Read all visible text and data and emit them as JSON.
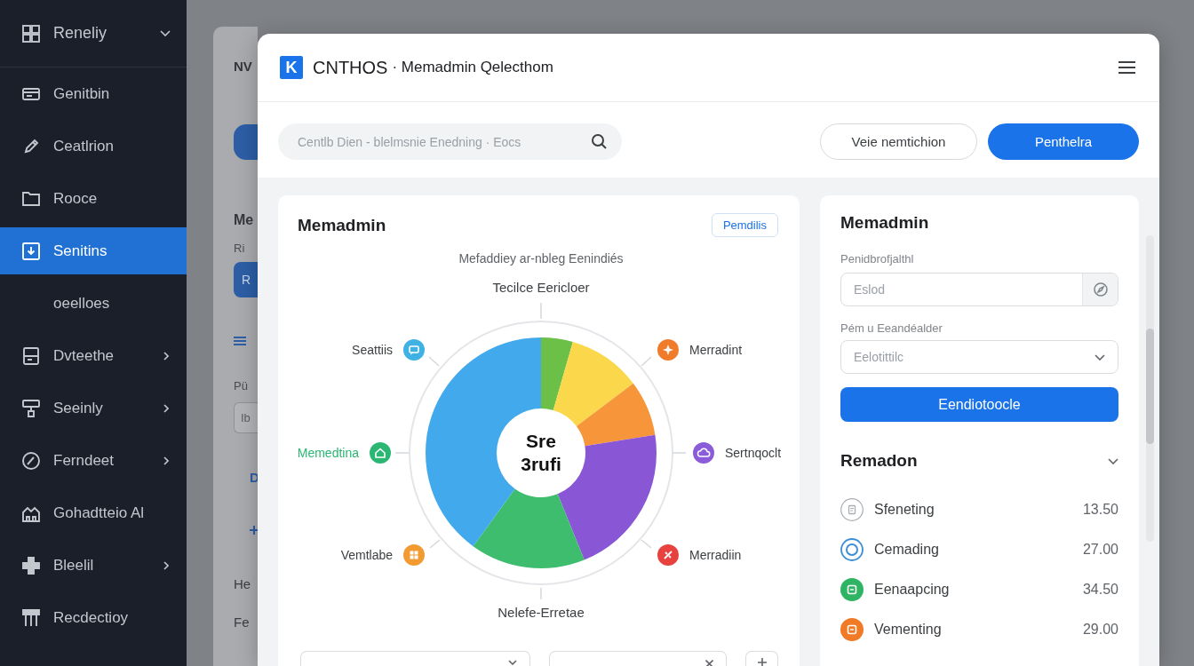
{
  "sidebar": {
    "header": {
      "label": "Reneliy",
      "expanded": true
    },
    "items": [
      {
        "label": "Genitbin",
        "selected": false,
        "has_submenu": false,
        "expanded": false
      },
      {
        "label": "Ceatlrion",
        "selected": false,
        "has_submenu": false,
        "expanded": false
      },
      {
        "label": "Rooce",
        "selected": false,
        "has_submenu": false,
        "expanded": false
      },
      {
        "label": "Senitins",
        "selected": true,
        "has_submenu": false,
        "expanded": false,
        "children": [
          {
            "label": "oeelloes",
            "selected": false
          }
        ]
      },
      {
        "label": "Dvteethe",
        "selected": false,
        "has_submenu": true,
        "expanded": false
      },
      {
        "label": "Seeinly",
        "selected": false,
        "has_submenu": true,
        "expanded": false
      },
      {
        "label": "Ferndeet",
        "selected": false,
        "has_submenu": true,
        "expanded": false
      },
      {
        "label": "Gohadtteio Al",
        "selected": false,
        "has_submenu": false,
        "expanded": false
      },
      {
        "label": "Bleelil",
        "selected": false,
        "has_submenu": true,
        "expanded": false
      },
      {
        "label": "Recdectioy",
        "selected": false,
        "has_submenu": false,
        "expanded": false
      }
    ]
  },
  "background_page": {
    "title": "NV",
    "heading": "Me",
    "caption": "Ri",
    "button": "R",
    "field_label": "Pü",
    "field_value": "Ib",
    "tab": "D",
    "rows": [
      "He",
      "Fe"
    ]
  },
  "modal": {
    "logo": "K",
    "brand": "CNTHOS",
    "title": "· Memadmin Qelecthom",
    "search": {
      "placeholder": "Centlb Dien - blelmsnie Enedning · Eocs"
    },
    "buttons": [
      {
        "label": "Veie nemtichion",
        "kind": "secondary"
      },
      {
        "label": "Penthelra",
        "kind": "primary"
      }
    ],
    "chart_card": {
      "title": "Memadmin",
      "badge": "Pemdilis",
      "subtitle": "Mefaddiey ar-nbleg Eenindiés",
      "top_label": "Tecilce Eericloer",
      "center_label": "Sre 3rufi",
      "callouts": [
        {
          "label": "Seattiis",
          "color": "#3fb1e3",
          "highlighted": false
        },
        {
          "label": "Merradint",
          "color": "#f07c2b",
          "highlighted": false
        },
        {
          "label": "Memedtina",
          "color": "#2bb673",
          "highlighted": true
        },
        {
          "label": "Sertnqoclt",
          "color": "#8b5cd9",
          "highlighted": false
        },
        {
          "label": "Vemtlabe",
          "color": "#f39b33",
          "highlighted": false
        },
        {
          "label": "Merradiin",
          "color": "#e8423f",
          "highlighted": false
        }
      ],
      "bottom_label": "Nelefe-Erretae",
      "filters": [
        {
          "kind": "select"
        },
        {
          "kind": "clearable"
        },
        {
          "kind": "add"
        }
      ]
    },
    "form_card": {
      "title": "Memadmin",
      "fields": [
        {
          "label": "Penidbrofjalthl",
          "kind": "input",
          "placeholder": "Eslod"
        },
        {
          "label": "Pém u Eeandéalder",
          "kind": "select",
          "placeholder": "Eelotittilc"
        }
      ],
      "submit": "Eendiotoocle",
      "section": {
        "title": "Remadon",
        "expanded": true,
        "rows": [
          {
            "name": "Sfeneting",
            "value": "13.50",
            "kind": "outline",
            "color": "#a9aeb4"
          },
          {
            "name": "Cemading",
            "value": "27.00",
            "kind": "ring",
            "color": "#3b8fd9"
          },
          {
            "name": "Eenaapcing",
            "value": "34.50",
            "kind": "disc",
            "color": "#2fb463"
          },
          {
            "name": "Vementing",
            "value": "29.00",
            "kind": "disc",
            "color": "#f07a26"
          }
        ]
      }
    }
  }
}
